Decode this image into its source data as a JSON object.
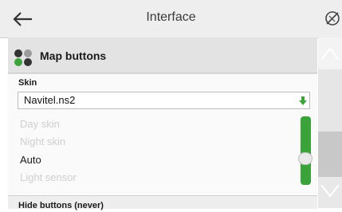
{
  "header": {
    "title": "Interface",
    "back_icon": "arrow-left-icon",
    "right_icon": "no-location-icon"
  },
  "section": {
    "icon": "map-buttons-icon",
    "label": "Map buttons"
  },
  "skin": {
    "label": "Skin",
    "selected": "Navitel.ns2",
    "options": [
      "Day skin",
      "Night skin",
      "Auto",
      "Light sensor"
    ],
    "active_option": "Auto"
  },
  "hide_buttons": {
    "label": "Hide buttons (never)"
  },
  "slider": {
    "level": 0.33,
    "color": "#3aa33a"
  },
  "scrollbar": {
    "up_icon": "chevron-up-icon",
    "down_icon": "chevron-down-icon"
  }
}
